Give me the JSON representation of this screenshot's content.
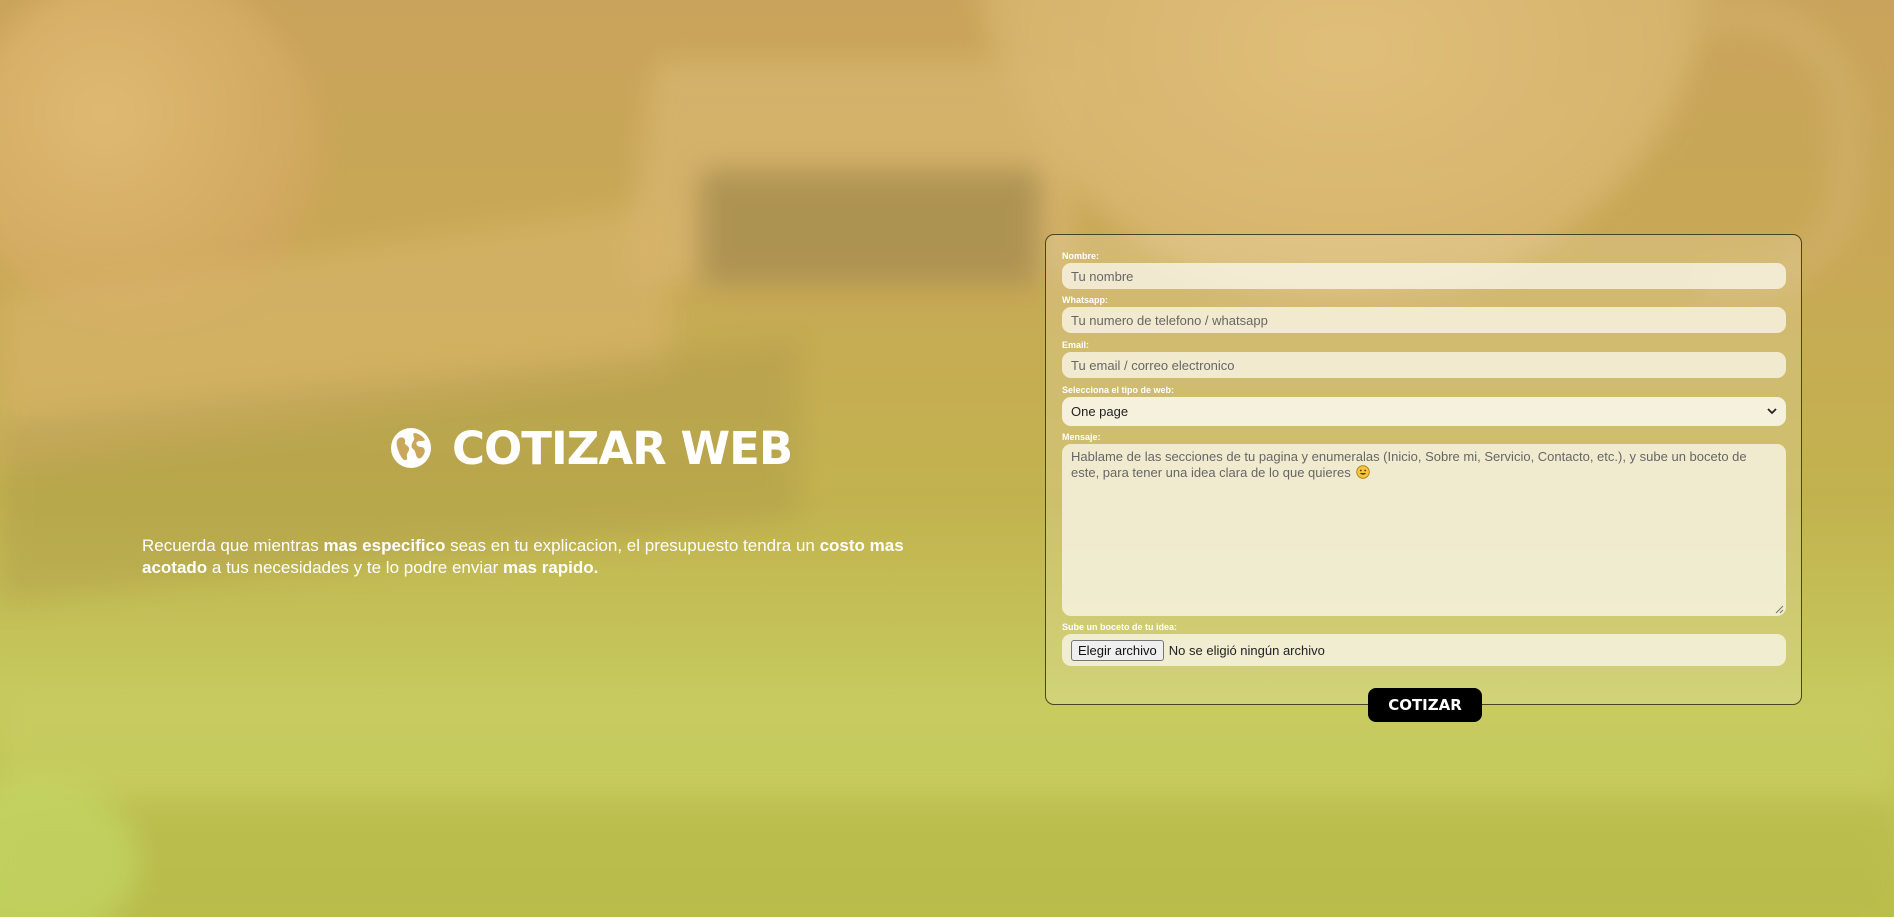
{
  "hero": {
    "icon": "globe-icon",
    "title": "COTIZAR WEB",
    "text": {
      "p1": "Recuerda que mientras ",
      "b1": "mas especifico",
      "p2": " seas en tu explicacion, el presupuesto tendra un ",
      "b2": "costo mas acotado",
      "p3": " a tus necesidades y te lo podre enviar ",
      "b3": "mas rapido."
    }
  },
  "form": {
    "name": {
      "label": "Nombre:",
      "placeholder": "Tu nombre"
    },
    "whatsapp": {
      "label": "Whatsapp:",
      "placeholder": "Tu numero de telefono / whatsapp"
    },
    "email": {
      "label": "Email:",
      "placeholder": "Tu email / correo electronico"
    },
    "web_type": {
      "label": "Selecciona el tipo de web:",
      "selected": "One page"
    },
    "message": {
      "label": "Mensaje:",
      "placeholder": "Hablame de las secciones de tu pagina y enumeralas (Inicio, Sobre mi, Servicio, Contacto, etc.), y sube un boceto de este, para tener una idea clara de lo que quieres"
    },
    "upload": {
      "label": "Sube un boceto de tu idea:",
      "button": "Elegir archivo",
      "status": "No se eligió ningún archivo"
    },
    "submit": "COTIZAR"
  },
  "colors": {
    "overlay": "#c9a35b",
    "text": "#ffffff",
    "button": "#000000"
  }
}
